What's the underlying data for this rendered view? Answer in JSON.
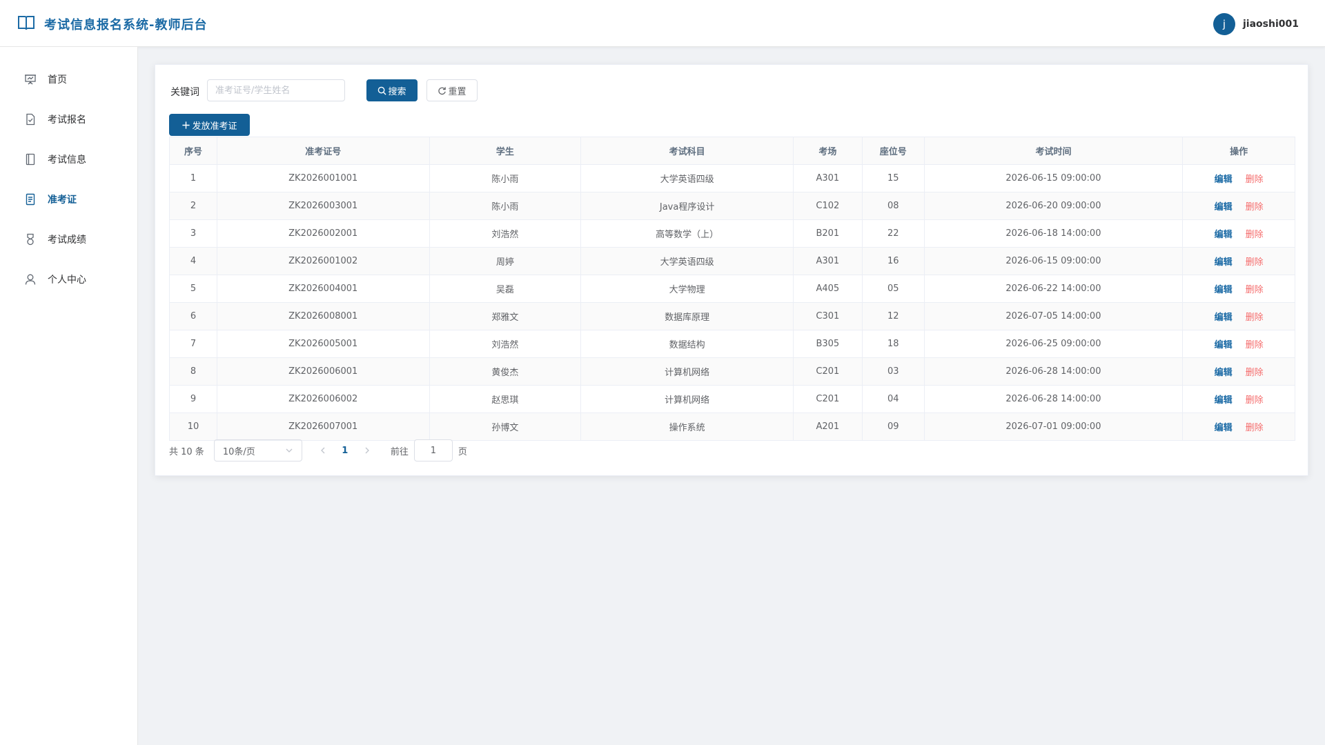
{
  "header": {
    "title": "考试信息报名系统-教师后台",
    "avatar_letter": "j",
    "username": "jiaoshi001"
  },
  "sidebar": {
    "items": [
      {
        "label": "首页",
        "icon": "presentation-icon",
        "active": false
      },
      {
        "label": "考试报名",
        "icon": "document-check-icon",
        "active": false
      },
      {
        "label": "考试信息",
        "icon": "notebook-icon",
        "active": false
      },
      {
        "label": "准考证",
        "icon": "list-document-icon",
        "active": true
      },
      {
        "label": "考试成绩",
        "icon": "medal-icon",
        "active": false
      },
      {
        "label": "个人中心",
        "icon": "user-icon",
        "active": false
      }
    ]
  },
  "toolbar": {
    "keyword_label": "关键词",
    "keyword_placeholder": "准考证号/学生姓名",
    "keyword_value": "",
    "search_label": "搜索",
    "reset_label": "重置",
    "add_label": "发放准考证"
  },
  "table": {
    "columns": [
      "序号",
      "准考证号",
      "学生",
      "考试科目",
      "考场",
      "座位号",
      "考试时间",
      "操作"
    ],
    "edit_label": "编辑",
    "delete_label": "删除",
    "rows": [
      {
        "no": "1",
        "ticket": "ZK2026001001",
        "student": "陈小雨",
        "subject": "大学英语四级",
        "room": "A301",
        "seat": "15",
        "time": "2026-06-15 09:00:00"
      },
      {
        "no": "2",
        "ticket": "ZK2026003001",
        "student": "陈小雨",
        "subject": "Java程序设计",
        "room": "C102",
        "seat": "08",
        "time": "2026-06-20 09:00:00"
      },
      {
        "no": "3",
        "ticket": "ZK2026002001",
        "student": "刘浩然",
        "subject": "高等数学（上）",
        "room": "B201",
        "seat": "22",
        "time": "2026-06-18 14:00:00"
      },
      {
        "no": "4",
        "ticket": "ZK2026001002",
        "student": "周婷",
        "subject": "大学英语四级",
        "room": "A301",
        "seat": "16",
        "time": "2026-06-15 09:00:00"
      },
      {
        "no": "5",
        "ticket": "ZK2026004001",
        "student": "吴磊",
        "subject": "大学物理",
        "room": "A405",
        "seat": "05",
        "time": "2026-06-22 14:00:00"
      },
      {
        "no": "6",
        "ticket": "ZK2026008001",
        "student": "郑雅文",
        "subject": "数据库原理",
        "room": "C301",
        "seat": "12",
        "time": "2026-07-05 14:00:00"
      },
      {
        "no": "7",
        "ticket": "ZK2026005001",
        "student": "刘浩然",
        "subject": "数据结构",
        "room": "B305",
        "seat": "18",
        "time": "2026-06-25 09:00:00"
      },
      {
        "no": "8",
        "ticket": "ZK2026006001",
        "student": "黄俊杰",
        "subject": "计算机网络",
        "room": "C201",
        "seat": "03",
        "time": "2026-06-28 14:00:00"
      },
      {
        "no": "9",
        "ticket": "ZK2026006002",
        "student": "赵思琪",
        "subject": "计算机网络",
        "room": "C201",
        "seat": "04",
        "time": "2026-06-28 14:00:00"
      },
      {
        "no": "10",
        "ticket": "ZK2026007001",
        "student": "孙博文",
        "subject": "操作系统",
        "room": "A201",
        "seat": "09",
        "time": "2026-07-01 09:00:00"
      }
    ]
  },
  "pagination": {
    "total_text": "共 10 条",
    "page_size": "10条/页",
    "current_page": "1",
    "goto_label": "前往",
    "goto_value": "1",
    "page_suffix": "页"
  },
  "colors": {
    "primary": "#135f96",
    "danger": "#f56c6c",
    "background": "#f0f2f5"
  }
}
